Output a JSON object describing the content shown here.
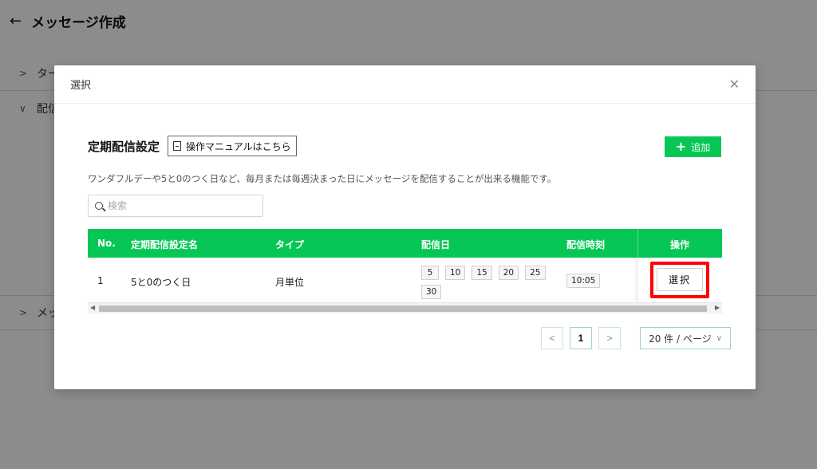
{
  "background": {
    "page_title": "メッセージ作成",
    "rows": [
      {
        "label": "ター",
        "chevron": ">"
      },
      {
        "label": "配信",
        "chevron": "∨"
      },
      {
        "label": "メッ",
        "chevron": ">"
      }
    ]
  },
  "modal": {
    "title": "選択",
    "section_title": "定期配信設定",
    "manual_button": "操作マニュアルはこちら",
    "add_button": "追加",
    "description": "ワンダフルデーや5と0のつく日など、毎月または毎週決まった日にメッセージを配信することが出来る機能です。",
    "search_placeholder": "検索"
  },
  "table": {
    "headers": {
      "no": "No.",
      "name": "定期配信設定名",
      "type": "タイプ",
      "day": "配信日",
      "time": "配信時刻",
      "action": "操作"
    },
    "rows": [
      {
        "no": "1",
        "name": "5と0のつく日",
        "type": "月単位",
        "days": [
          "5",
          "10",
          "15",
          "20",
          "25",
          "30"
        ],
        "time": "10:05",
        "action": "選択"
      }
    ]
  },
  "pagination": {
    "prev": "<",
    "current": "1",
    "next": ">",
    "page_size": "20 件 / ページ"
  },
  "colors": {
    "accent": "#06c755",
    "highlight": "#ff0000"
  }
}
